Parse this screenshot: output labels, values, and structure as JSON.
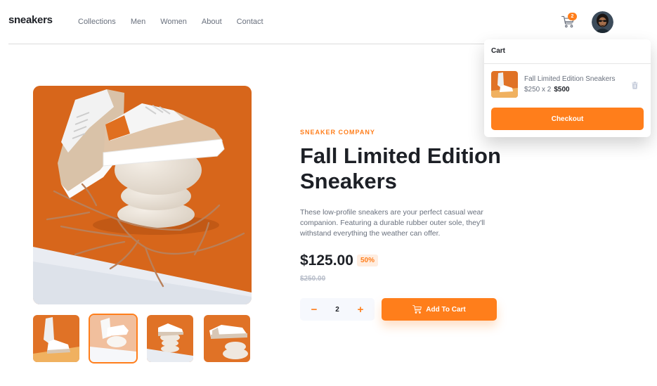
{
  "header": {
    "logo": "sneakers",
    "nav": [
      "Collections",
      "Men",
      "Women",
      "About",
      "Contact"
    ],
    "cart_count": "2"
  },
  "product": {
    "company": "SNEAKER COMPANY",
    "title": "Fall Limited Edition Sneakers",
    "description": "These low-profile sneakers are your perfect casual wear companion. Featuring a durable rubber outer sole, they'll withstand everything the weather can offer.",
    "price": "$125.00",
    "discount": "50%",
    "old_price": "$250.00",
    "quantity": "2",
    "minus": "−",
    "plus": "+",
    "add_to_cart": "Add To Cart",
    "selected_thumbnail": 2
  },
  "cart": {
    "title": "Cart",
    "item_name": "Fall Limited Edition Sneakers",
    "item_calc": "$250 x 2",
    "item_total": "$500",
    "checkout": "Checkout"
  },
  "colors": {
    "accent": "#ff7e1b",
    "accent_pale": "#ffede0",
    "text_dark": "#1d2026",
    "text_grey": "#69707d"
  },
  "icons": [
    "cart-icon",
    "trash-icon",
    "minus-icon",
    "plus-icon"
  ]
}
